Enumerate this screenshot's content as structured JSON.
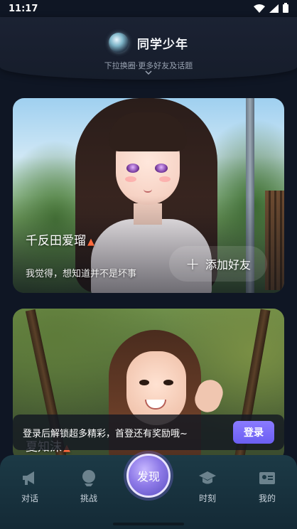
{
  "status_bar": {
    "time": "11:17"
  },
  "header": {
    "title": "同学少年",
    "pull_hint": "下拉换圈·更多好友及话题"
  },
  "cards": [
    {
      "name": "千反田爱瑠",
      "bio": "我觉得，想知道并不是坏事",
      "add_friend_label": "添加好友"
    },
    {
      "name": "夏知沫"
    }
  ],
  "login_banner": {
    "text": "登录后解锁超多精彩，首登还有奖励哦~",
    "button_label": "登录"
  },
  "bottom_nav": {
    "items": [
      {
        "label": "对话",
        "icon": "megaphone-icon"
      },
      {
        "label": "挑战",
        "icon": "globe-icon"
      },
      {
        "label": "发现",
        "icon": "discover-orb"
      },
      {
        "label": "时刻",
        "icon": "graduation-cap-icon"
      },
      {
        "label": "我的",
        "icon": "id-card-icon"
      }
    ]
  },
  "colors": {
    "background": "#0f1624",
    "accent": "#7b6cf6",
    "nav_background": "#1c3a46"
  }
}
